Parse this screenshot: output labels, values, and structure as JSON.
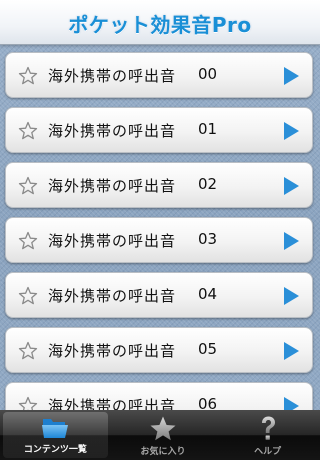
{
  "header": {
    "title": "ポケット効果音Pro"
  },
  "list": {
    "rows": [
      {
        "title": "海外携帯の呼出音",
        "number": "00"
      },
      {
        "title": "海外携帯の呼出音",
        "number": "01"
      },
      {
        "title": "海外携帯の呼出音",
        "number": "02"
      },
      {
        "title": "海外携帯の呼出音",
        "number": "03"
      },
      {
        "title": "海外携帯の呼出音",
        "number": "04"
      },
      {
        "title": "海外携帯の呼出音",
        "number": "05"
      },
      {
        "title": "海外携帯の呼出音",
        "number": "06"
      }
    ]
  },
  "tabbar": {
    "tabs": [
      {
        "label": "コンテンツ一覧",
        "icon": "folder-icon",
        "active": true
      },
      {
        "label": "お気に入り",
        "icon": "star-icon",
        "active": false
      },
      {
        "label": "ヘルプ",
        "icon": "help-icon",
        "active": false
      }
    ]
  },
  "colors": {
    "title_blue": "#1a8fd6",
    "play_blue": "#2a8fd8",
    "tab_active_icon": "#39a0ea"
  }
}
